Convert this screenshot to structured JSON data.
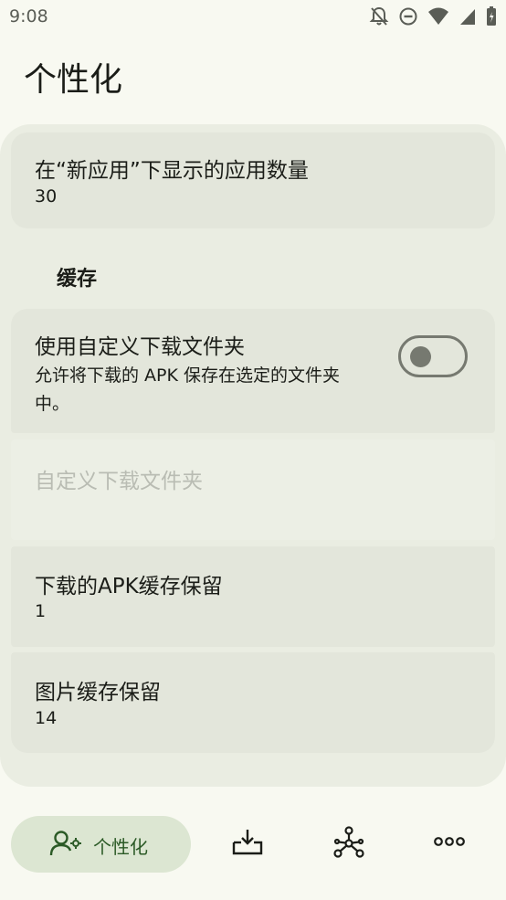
{
  "status_bar": {
    "time": "9:08"
  },
  "header": {
    "title": "个性化"
  },
  "settings": {
    "new_apps_count": {
      "title": "在“新应用”下显示的应用数量",
      "value": "30"
    },
    "cache_section": {
      "label": "缓存"
    },
    "custom_download_folder": {
      "title": "使用自定义下载文件夹",
      "description": "允许将下载的 APK 保存在选定的文件夹中。",
      "enabled": false
    },
    "download_folder": {
      "title": "自定义下载文件夹"
    },
    "apk_cache": {
      "title": "下载的APK缓存保留",
      "value": "1"
    },
    "image_cache": {
      "title": "图片缓存保留",
      "value": "14"
    }
  },
  "bottom_nav": {
    "active_label": "个性化",
    "items": [
      "personalization-icon",
      "downloads-icon",
      "repositories-icon",
      "more-icon"
    ]
  },
  "colors": {
    "accent": "#2b5a26",
    "active_nav_bg": "#dce6d2",
    "panel_bg": "#eaede2",
    "card_bg": "#e3e6db"
  }
}
